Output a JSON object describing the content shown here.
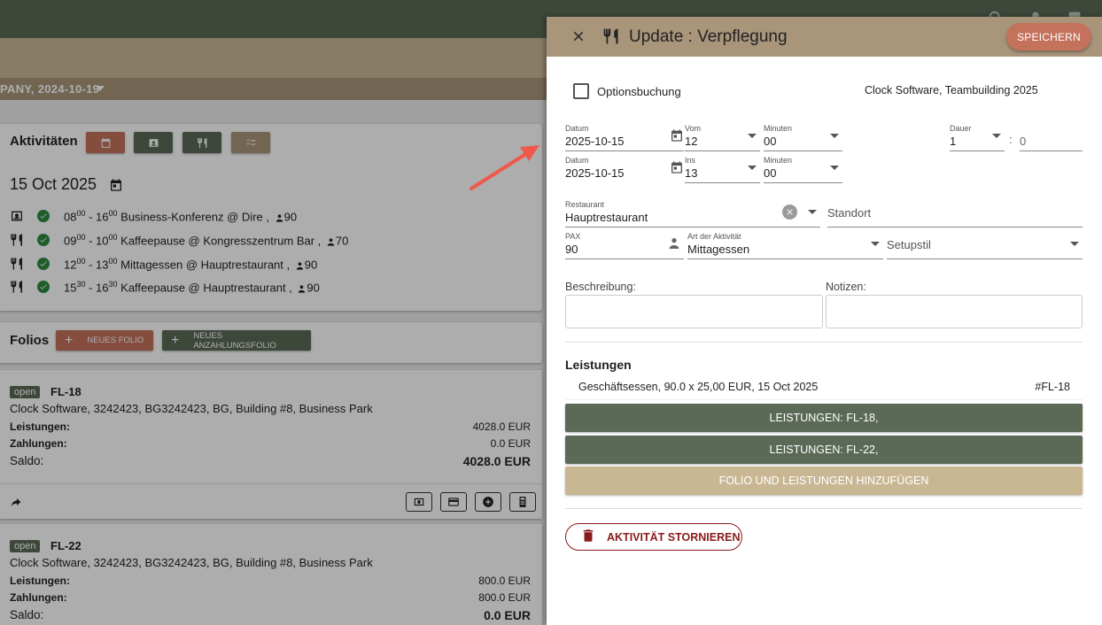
{
  "colors": {
    "topbar": "#5b6a57",
    "band": "#c9b794",
    "band_dark": "#a8957a",
    "red_button": "#c4725b",
    "green_button": "#5b6a57",
    "tan_button": "#a8957a",
    "danger": "#8b1a1a",
    "check_green": "#2d8a3e"
  },
  "background": {
    "event_selector": "PANY, 2024-10-19",
    "activities": {
      "heading": "Aktivitäten",
      "date": "15 Oct 2025",
      "rows": [
        {
          "type_icon": "contact-card-icon",
          "start_h": "08",
          "start_m": "00",
          "end_h": "16",
          "end_m": "00",
          "text": "Business-Konferenz @ Dire ,",
          "pax": "90"
        },
        {
          "type_icon": "fork-knife-icon",
          "start_h": "09",
          "start_m": "00",
          "end_h": "10",
          "end_m": "00",
          "text": "Kaffeepause @ Kongresszentrum Bar ,",
          "pax": "70"
        },
        {
          "type_icon": "fork-knife-icon",
          "start_h": "12",
          "start_m": "00",
          "end_h": "13",
          "end_m": "00",
          "text": "Mittagessen @ Hauptrestaurant ,",
          "pax": "90"
        },
        {
          "type_icon": "fork-knife-icon",
          "start_h": "15",
          "start_m": "30",
          "end_h": "16",
          "end_m": "30",
          "text": "Kaffeepause @ Hauptrestaurant ,",
          "pax": "90"
        }
      ]
    },
    "folios": {
      "heading": "Folios",
      "new_folio_label": "NEUES FOLIO",
      "new_deposit_folio_label": "NEUES ANZAHLUNGSFOLIO",
      "items": [
        {
          "status": "open",
          "id": "FL-18",
          "address": "Clock Software, 3242423, BG3242423, BG, Building #8, Business Park",
          "leistungen_label": "Leistungen:",
          "leistungen": "4028.0 EUR",
          "zahlungen_label": "Zahlungen:",
          "zahlungen": "0.0 EUR",
          "saldo_label": "Saldo:",
          "saldo": "4028.0 EUR"
        },
        {
          "status": "open",
          "id": "FL-22",
          "address": "Clock Software, 3242423, BG3242423, BG, Building #8, Business Park",
          "leistungen_label": "Leistungen:",
          "leistungen": "800.0 EUR",
          "zahlungen_label": "Zahlungen:",
          "zahlungen": "800.0 EUR",
          "saldo_label": "Saldo:",
          "saldo": "0.0 EUR"
        }
      ]
    }
  },
  "drawer": {
    "title": "Update : Verpflegung",
    "save_label": "SPEICHERN",
    "option_booking_label": "Optionsbuchung",
    "option_booking_checked": false,
    "company": "Clock Software, Teambuilding 2025",
    "row1": {
      "date_label": "Datum",
      "date": "2025-10-15",
      "hour_label": "Vom",
      "hour": "12",
      "minute_label": "Minuten",
      "minute": "00",
      "duration_label": "Dauer",
      "duration_h": "1",
      "colon": ":",
      "duration_m": "0"
    },
    "row2": {
      "date_label": "Datum",
      "date": "2025-10-15",
      "hour_label": "Ins",
      "hour": "13",
      "minute_label": "Minuten",
      "minute": "00"
    },
    "restaurant_label": "Restaurant",
    "restaurant": "Hauptrestaurant",
    "location_placeholder": "Standort",
    "pax_label": "PAX",
    "pax": "90",
    "activity_type_label": "Art der Aktivität",
    "activity_type": "Mittagessen",
    "setup_placeholder": "Setupstil",
    "description_label": "Beschreibung:",
    "notes_label": "Notizen:",
    "leistungen_title": "Leistungen",
    "leistung_item": {
      "text": "Geschäftsessen, 90.0 x 25,00 EUR, 15 Oct 2025",
      "folio": "#FL-18"
    },
    "btn_fl18": "LEISTUNGEN: FL-18,",
    "btn_fl22": "LEISTUNGEN: FL-22,",
    "btn_add": "FOLIO UND LEISTUNGEN HINZUFÜGEN",
    "cancel_label": "AKTIVITÄT STORNIEREN"
  }
}
